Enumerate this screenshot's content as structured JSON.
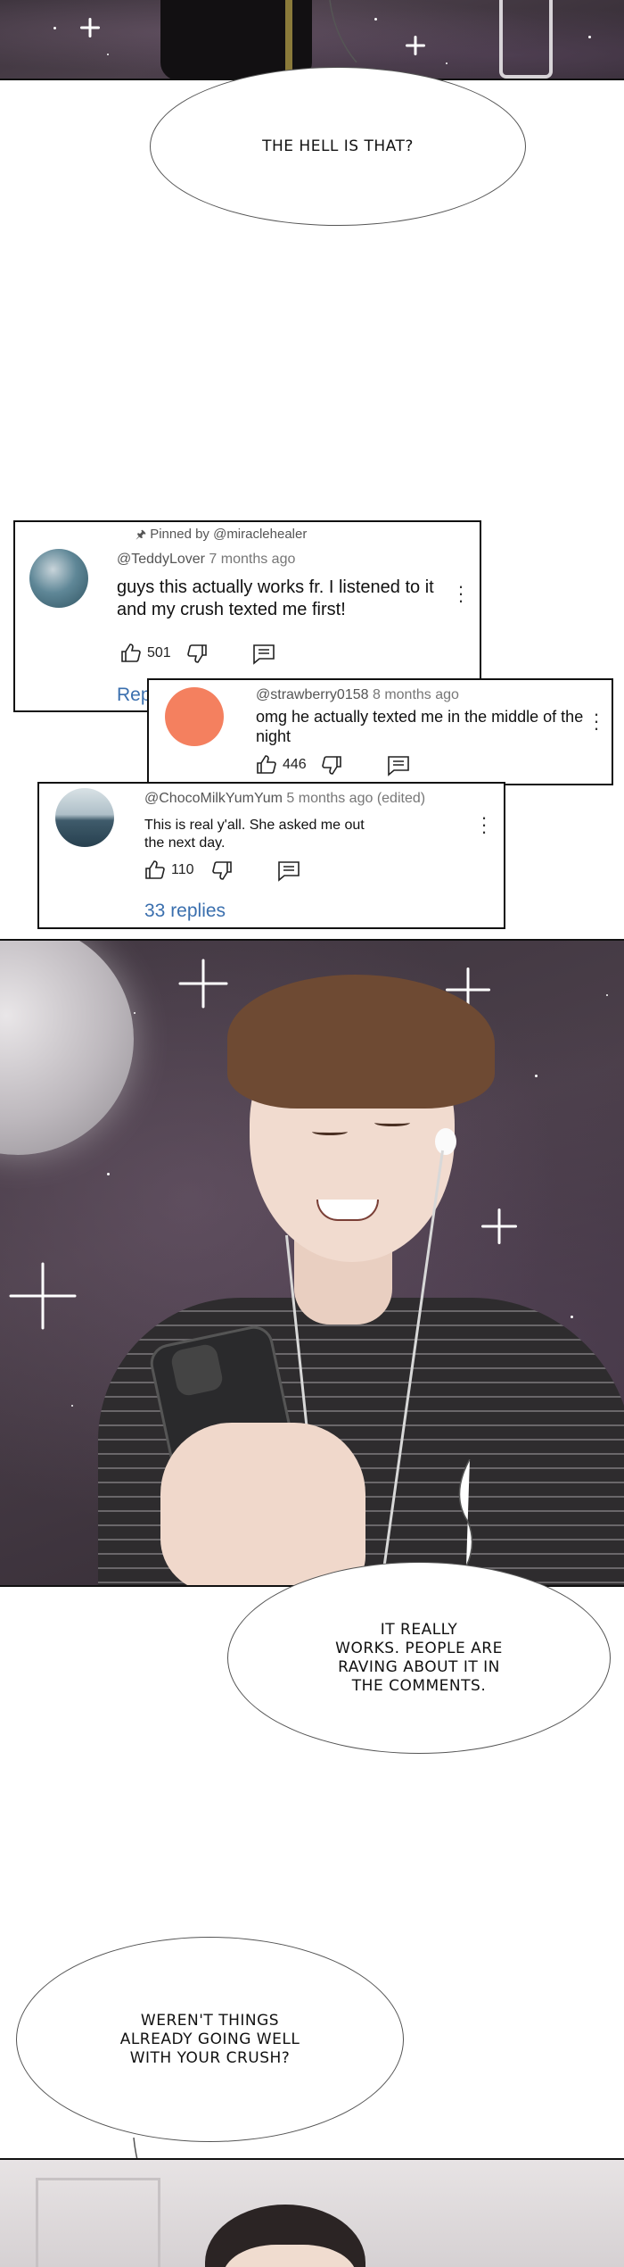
{
  "bubbles": {
    "top": "THE HELL IS THAT?",
    "works": "IT REALLY\nWORKS. PEOPLE ARE\nRAVING ABOUT IT IN\nTHE COMMENTS.",
    "crush": "WEREN'T THINGS\nALREADY GOING WELL\nWITH YOUR CRUSH?"
  },
  "comments": [
    {
      "pinned": "Pinned by @miraclehealer",
      "user": "@TeddyLover",
      "ago": "7 months ago",
      "text": "guys this actually works fr. I listened to it and my crush texted me first!",
      "likes": "501",
      "replies": "Rep"
    },
    {
      "user": "@strawberry0158",
      "ago": "8 months ago",
      "text": "omg he actually texted me in the middle of the night",
      "likes": "446"
    },
    {
      "user": "@ChocoMilkYumYum",
      "ago": "5 months ago (edited)",
      "text": "This is real y'all. She asked me out the next day.",
      "likes": "110",
      "replies": "33 replies"
    }
  ],
  "colors": {
    "avatar_strawberry": "#f4805f",
    "reply_link": "#3a6fae"
  }
}
